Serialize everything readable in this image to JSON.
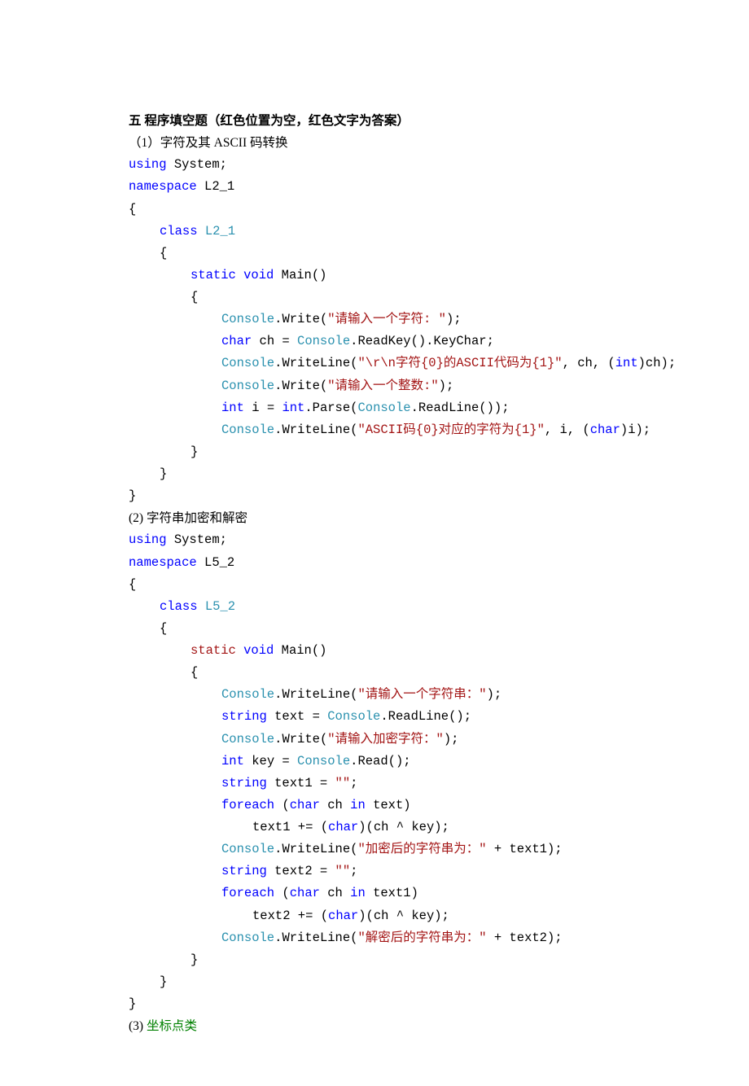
{
  "title": "五 程序填空题（红色位置为空，红色文字为答案）",
  "s1": {
    "h": "（1）字符及其 ASCII 码转换",
    "c": {
      "using_kw": "using",
      "system": " System;",
      "ns_kw": "namespace",
      "ns": " L2_1",
      "ob": "{",
      "cb": "}",
      "class_kw": "class ",
      "class": "L2_1",
      "static": "static ",
      "void": "void ",
      "main": "Main()",
      "cons": "Console",
      "dot": ".",
      "wr": "Write(",
      "wl": "WriteLine(",
      "s_prompt1": "\"请输入一个字符: \"",
      "rp": ");",
      "char_kw": "char ",
      "ch": "ch = ",
      "rk": ".ReadKey().KeyChar;",
      "s_fmt1": "\"\\r\\n字符{0}的ASCII代码为{1}\"",
      "tail1": ", ch, (",
      "int_cast": "int",
      "tail1b": ")ch);",
      "s_prompt2": "\"请输入一个整数:\"",
      "int_kw": "int ",
      "ivar": "i = ",
      "int2": "int",
      "parse": ".Parse(",
      "rl": ".ReadLine());",
      "s_fmt2": "\"ASCII码{0}对应的字符为{1}\"",
      "tail2": ", i, (",
      "char_cast": "char",
      "tail2b": ")i);"
    }
  },
  "s2": {
    "h": "(2) 字符串加密和解密",
    "c": {
      "using_kw": "using",
      "system": " System;",
      "ns_kw": "namespace",
      "ns": " L5_2",
      "ob": "{",
      "cb": "}",
      "class_kw": "class ",
      "class": "L5_2",
      "static": "static ",
      "void": "void ",
      "main": "Main()",
      "cons": "Console",
      "wl": "WriteLine(",
      "wr": "Write(",
      "s_prompt1": "\"请输入一个字符串：\"",
      "rp": ");",
      "string_kw": "string ",
      "txt": "text = ",
      "rl": ".ReadLine();",
      "s_prompt2": "\"请输入加密字符：\"",
      "int_kw": "int ",
      "key": "key = ",
      "rd": ".Read();",
      "txt1": "text1 = ",
      "empty": "\"\"",
      "semi": ";",
      "foreach": "foreach ",
      "op": "(",
      "char_kw": "char ",
      "chv": "ch ",
      "in_kw": "in ",
      "txtv": "text)",
      "txt1v": "text1)",
      "body1": "text1 += (",
      "char_cast": "char",
      "xor": ")(ch ^ key);",
      "s_out1": "\"加密后的字符串为：\"",
      "plus1": " + text1);",
      "txt2": "text2 = ",
      "body2": "text2 += (",
      "s_out2": "\"解密后的字符串为：\"",
      "plus2": " + text2);"
    }
  },
  "s3": {
    "h": "(3) ",
    "h2": "坐标点类"
  }
}
